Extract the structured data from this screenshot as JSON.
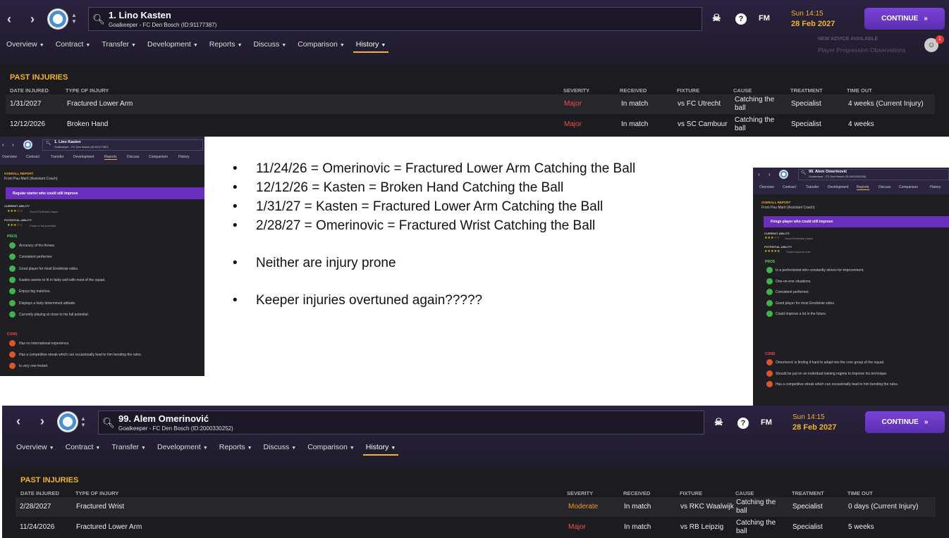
{
  "top": {
    "player_name": "1. Lino Kasten",
    "player_sub": "Goalkeeper - FC Den Bosch (ID:91177387)",
    "date_line1": "Sun 14:15",
    "date_line2": "28 Feb 2027",
    "continue_label": "CONTINUE",
    "fm_label": "FM",
    "help_label": "?",
    "tabs": [
      "Overview",
      "Contract",
      "Transfer",
      "Development",
      "Reports",
      "Discuss",
      "Comparison",
      "History"
    ],
    "advice_title": "NEW ADVICE AVAILABLE",
    "advice_text": "Player Progression Observations",
    "notif_count": "1",
    "section_title": "PAST INJURIES",
    "headers": {
      "date": "DATE INJURED",
      "type": "TYPE OF INJURY",
      "severity": "SEVERITY",
      "received": "RECEIVED",
      "fixture": "FIXTURE",
      "cause": "CAUSE",
      "treatment": "TREATMENT",
      "time": "TIME OUT"
    },
    "rows": [
      {
        "date": "1/31/2027",
        "type": "Fractured Lower Arm",
        "severity": "Major",
        "received": "In match",
        "fixture": "vs FC Utrecht",
        "cause": "Catching the ball",
        "treatment": "Specialist",
        "time": "4 weeks (Current Injury)"
      },
      {
        "date": "12/12/2026",
        "type": "Broken Hand",
        "severity": "Major",
        "received": "In match",
        "fixture": "vs SC Cambuur",
        "cause": "Catching the ball",
        "treatment": "Specialist",
        "time": "4 weeks"
      }
    ]
  },
  "bottom": {
    "player_name": "99. Alem Omerinović",
    "player_sub": "Goalkeeper - FC Den Bosch (ID:2000330252)",
    "date_line1": "Sun 14:15",
    "date_line2": "28 Feb 2027",
    "continue_label": "CONTINUE",
    "fm_label": "FM",
    "help_label": "?",
    "tabs": [
      "Overview",
      "Contract",
      "Transfer",
      "Development",
      "Reports",
      "Discuss",
      "Comparison",
      "History"
    ],
    "section_title": "PAST INJURIES",
    "headers": {
      "date": "DATE INJURED",
      "type": "TYPE OF INJURY",
      "severity": "SEVERITY",
      "received": "RECEIVED",
      "fixture": "FIXTURE",
      "cause": "CAUSE",
      "treatment": "TREATMENT",
      "time": "TIME OUT"
    },
    "rows": [
      {
        "date": "2/28/2027",
        "type": "Fractured Wrist",
        "severity": "Moderate",
        "received": "In match",
        "fixture": "vs RKC Waalwijk",
        "cause": "Catching the ball",
        "treatment": "Specialist",
        "time": "0 days (Current Injury)"
      },
      {
        "date": "11/24/2026",
        "type": "Fractured Lower Arm",
        "severity": "Major",
        "received": "In match",
        "fixture": "vs RB Leipzig",
        "cause": "Catching the ball",
        "treatment": "Specialist",
        "time": "5 weeks"
      }
    ]
  },
  "left_report": {
    "player_name": "1. Lino Kasten",
    "player_sub": "Goalkeeper - FC Den Bosch (ID:91177387)",
    "tabs": [
      "Overview",
      "Contract",
      "Transfer",
      "Development",
      "Reports",
      "Discuss",
      "Comparison",
      "History"
    ],
    "overall": "OVERALL REPORT",
    "from": "From Pau Martí (Assistant Coach)",
    "banner": "Regular starter who could still improve",
    "ca_label": "CURRENT ABILITY",
    "ca_text": "Good Eredivisie player",
    "pa_label": "POTENTIAL ABILITY",
    "pa_text": "Close to full potential",
    "ca_stars": "★★★☆☆",
    "pa_stars": "★★★☆☆",
    "pros_label": "PROS",
    "pros": [
      "Accuracy of his throws.",
      "Consistent performer.",
      "Good player for most Eredivisie sides.",
      "Kasten seems to fit in fairly well with most of the squad.",
      "Enjoys big matches.",
      "Displays a fairly determined attitude.",
      "Currently playing at close to his full potential."
    ],
    "cons_label": "CONS",
    "cons": [
      "Has no international experience.",
      "Has a competitive streak which can occasionally lead to him bending the rules.",
      "Is very one-footed."
    ]
  },
  "right_report": {
    "player_name": "99. Alem Omerinović",
    "player_sub": "Goalkeeper - FC Den Bosch (ID:2000330252)",
    "tabs": [
      "Overview",
      "Contract",
      "Transfer",
      "Development",
      "Reports",
      "Discuss",
      "Comparison",
      "History"
    ],
    "overall": "OVERALL REPORT",
    "from": "From Pau Martí (Assistant Coach)",
    "banner": "Fringe player who could still improve",
    "ca_label": "CURRENT ABILITY",
    "ca_text": "Good Eredivisie player",
    "pa_label": "POTENTIAL ABILITY",
    "pa_text": "Could improve a lot",
    "ca_stars": "★★★☆☆",
    "pa_stars": "★★★★★",
    "pros_label": "PROS",
    "pros": [
      "Is a perfectionist who constantly strives for improvement.",
      "One-on-one situations.",
      "Consistent performer.",
      "Good player for most Eredivisie sides.",
      "Could improve a lot in the future."
    ],
    "cons_label": "CONS",
    "cons": [
      "Omerinović is finding it hard to adapt into the core group of the squad.",
      "Should be put on an individual training regime to improve his technique.",
      "Has a competitive streak which can occasionally lead to him bending the rules."
    ]
  },
  "notes": {
    "lines": [
      "11/24/26 = Omerinovic = Fractured Lower Arm Catching the Ball",
      "12/12/26 = Kasten = Broken Hand Catching the Ball",
      "1/31/27 = Kasten = Fractured Lower Arm Catching the Ball",
      "2/28/27 = Omerinovic = Fractured Wrist Catching the Ball"
    ],
    "line5": "Neither are injury prone",
    "line6": "Keeper injuries overtuned again?????"
  }
}
